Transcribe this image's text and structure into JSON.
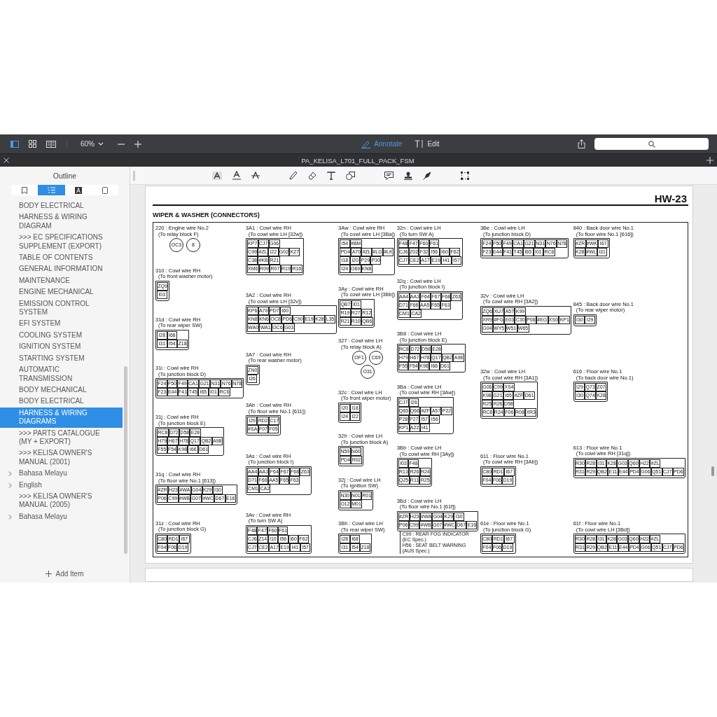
{
  "toolbar": {
    "views": [
      {
        "selected": true
      },
      {
        "selected": false
      },
      {
        "selected": false
      }
    ],
    "zoom": "60%",
    "modes": [
      {
        "label": "Annotate",
        "selected": true
      },
      {
        "label": "Edit",
        "selected": false
      }
    ]
  },
  "tab": {
    "title": "PA_KELISA_L701_FULL_PACK_FSM"
  },
  "sidebar": {
    "title": "Outline",
    "tabs": [
      {
        "selected": false
      },
      {
        "selected": true
      },
      {
        "selected": false
      },
      {
        "selected": false
      }
    ],
    "items": [
      {
        "label": "BODY ELECTRICAL",
        "kind": "entry",
        "selected": false
      },
      {
        "label": "HARNESS & WIRING DIAGRAM",
        "kind": "entry",
        "selected": false
      },
      {
        "label": ">>> EC SPECIFICATIONS SUPPLEMENT (EXPORT)",
        "kind": "entry",
        "selected": false
      },
      {
        "label": "TABLE OF CONTENTS",
        "kind": "entry",
        "selected": false
      },
      {
        "label": "GENERAL INFORMATION",
        "kind": "entry",
        "selected": false
      },
      {
        "label": "MAINTENANCE",
        "kind": "entry",
        "selected": false
      },
      {
        "label": "ENGINE MECHANICAL",
        "kind": "entry",
        "selected": false
      },
      {
        "label": "EMISSION CONTROL SYSTEM",
        "kind": "entry",
        "selected": false
      },
      {
        "label": "EFI SYSTEM",
        "kind": "entry",
        "selected": false
      },
      {
        "label": "COOLING SYSTEM",
        "kind": "entry",
        "selected": false
      },
      {
        "label": "IGNITION SYSTEM",
        "kind": "entry",
        "selected": false
      },
      {
        "label": "STARTING SYSTEM",
        "kind": "entry",
        "selected": false
      },
      {
        "label": "AUTOMATIC TRANSMISSION",
        "kind": "entry",
        "selected": false
      },
      {
        "label": "BODY MECHANICAL",
        "kind": "entry",
        "selected": false
      },
      {
        "label": "BODY ELECTRICAL",
        "kind": "entry",
        "selected": false
      },
      {
        "label": "HARNESS & WIRING DIAGRAMS",
        "kind": "entry",
        "selected": true
      },
      {
        "label": ">>> PARTS CATALOGUE (MY + EXPORT)",
        "kind": "entry",
        "selected": false
      },
      {
        "label": ">>> KELISA OWNER'S MANUAL (2001)",
        "kind": "entry",
        "selected": false
      },
      {
        "label": "Bahasa Melayu",
        "kind": "folder",
        "selected": false
      },
      {
        "label": "English",
        "kind": "folder",
        "selected": false
      },
      {
        "label": ">>> KELISA OWNER'S MANUAL (2005)",
        "kind": "entry",
        "selected": false
      },
      {
        "label": "Bahasa Melayu",
        "kind": "folder",
        "selected": false
      }
    ],
    "add_label": "Add Item"
  },
  "document": {
    "page_code": "HW-23",
    "heading": "WIPER & WASHER (CONNECTORS)",
    "columns": [
      [
        {
          "title": "220 : Engine wire No.2",
          "subtitle": "(To relay block F)",
          "kind": "round",
          "pins": [
            [
              "OC3",
              "8"
            ]
          ]
        },
        {
          "title": "310 : Cowl wire RH",
          "subtitle": "(To front washer motor)",
          "kind": "grid",
          "pins": [
            [
              "ZQ9"
            ],
            [
              "I03"
            ]
          ]
        },
        {
          "title": "31d : Cowl wire RH",
          "subtitle": "(To rear wiper SW)",
          "kind": "grid",
          "pins": [
            [
              "I28",
              "I68"
            ],
            [
              "I31",
              "I54",
              "Z18"
            ]
          ]
        },
        {
          "title": "31i : Cowl wire RH",
          "subtitle": "(To junction block D)",
          "kind": "grid",
          "pins": [
            [
              "F24",
              "F50",
              "F49",
              "CA1",
              "G21",
              "N31",
              "N76",
              "N78"
            ],
            [
              "F23",
              "E44",
              "F41",
              "T45",
              "I65",
              "I01",
              "RC6"
            ]
          ]
        },
        {
          "title": "31j : Cowl wire RH",
          "subtitle": "(To junction block E)",
          "kind": "grid",
          "pins": [
            [
              "RC8",
              "D72",
              "D58",
              "E28"
            ],
            [
              "H79",
              "H67",
              "H78",
              "Q17",
              "QB2",
              "A98"
            ],
            [
              "F55",
              "F54",
              "K98",
              "I66",
              "D61"
            ]
          ]
        },
        {
          "title": "31q : Cowl wire RH",
          "subtitle": "(To floor wire No.1 [613])",
          "kind": "grid",
          "pins": [
            [
              "#ZR",
              "H23",
              "#WA",
              "G04",
              "K29",
              "I30"
            ],
            [
              "P06",
              "C99",
              "#WB",
              "G07",
              "#WC",
              "D67",
              "E16"
            ]
          ]
        },
        {
          "title": "31z : Cowl wire RH",
          "subtitle": "(To junction block G)",
          "kind": "grid",
          "pins": [
            [
              "C80",
              "RD1",
              "I67"
            ],
            [
              "F04",
              "F06",
              "D19"
            ]
          ]
        }
      ],
      [
        {
          "title": "3A1 : Cowl wire RH",
          "subtitle": "(To cowl wire LH [32w])",
          "kind": "grid",
          "pins": [
            [
              "KP7",
              "CJ7",
              "G06"
            ],
            [
              "C99",
              "#ZL",
              "I22",
              "G02",
              "K27"
            ],
            [
              "C38",
              "#KB",
              "R21"
            ],
            [
              "XM6",
              "R09",
              "R07",
              "R19",
              "R16"
            ]
          ]
        },
        {
          "title": "3A2 : Cowl wire RH",
          "subtitle": "(To cowl wire LH [32v])",
          "kind": "grid",
          "pins": [
            [
              "KP6",
              "A70",
              "PD7",
              "I60"
            ],
            [
              "KN8",
              "KN6",
              "OC8",
              "PD6",
              "C90",
              "E19",
              "K28",
              "L35"
            ],
            [
              "WA0",
              "WA1",
              "OC6",
              "G03"
            ]
          ]
        },
        {
          "title": "3A7 : Cowl wire RH",
          "subtitle": "(To rear washer motor)",
          "kind": "grid",
          "pins": [
            [
              "ZN0"
            ],
            [
              "I26"
            ]
          ]
        },
        {
          "title": "3Ab : Cowl wire RH",
          "subtitle": "(To floor wire No.1 [611])",
          "kind": "grid",
          "pins": [
            [
              "I29",
              "RD2",
              "C17"
            ],
            [
              "#SA",
              "F07",
              "F05"
            ]
          ]
        },
        {
          "title": "3As : Cowl wire RH",
          "subtitle": "(To junction block I)",
          "kind": "grid",
          "pins": [
            [
              "AA4",
              "AA3",
              "F64",
              "F67",
              "F68",
              "Z63"
            ],
            [
              "D71",
              "F66",
              "AA5",
              "F65",
              "F63"
            ],
            [
              "CM1",
              "CA2"
            ]
          ]
        },
        {
          "title": "3Av : Cowl wire RH",
          "subtitle": "(To turn SW A)",
          "kind": "grid",
          "pins": [
            [
              "F48",
              "F47",
              "F60",
              "F61"
            ],
            [
              "CJ6",
              "Z14",
              "I10",
              "I56",
              "I60",
              "F62"
            ],
            [
              "CJ7",
              "CE2",
              "A17",
              "E19",
              "I41",
              "I57"
            ]
          ]
        }
      ],
      [
        {
          "title": "3Aw : Cowl wire RH",
          "subtitle": "(To cowl wire LH [3Ba])",
          "kind": "grid",
          "pins": [
            [
              "I54",
              "#BM"
            ],
            [
              "PD4",
              "A70",
              "#ZL",
              "#LG",
              "#LK"
            ],
            [
              "I18",
              "I20",
              "P29",
              "P30"
            ],
            [
              "I24",
              "O69",
              "KN8"
            ]
          ]
        },
        {
          "title": "3Ay : Cowl wire RH",
          "subtitle": "(To cowl wire LH [3Bb])",
          "kind": "grid",
          "pins": [
            [
              "QB7",
              "I01"
            ],
            [
              "R19",
              "R27",
              "R12"
            ],
            [
              "R21",
              "R10",
              "QB6"
            ]
          ]
        },
        {
          "title": "327 : Cowl wire LH",
          "subtitle": "(To relay block A)",
          "kind": "round",
          "pins": [
            [
              "OF1",
              "C69"
            ],
            [
              "O31"
            ]
          ]
        },
        {
          "title": "32c : Cowl wire LH",
          "subtitle": "(To front wiper motor)",
          "kind": "grid",
          "pins": [
            [
              "I20",
              "I18"
            ],
            [
              "I24",
              "I22"
            ]
          ]
        },
        {
          "title": "32h : Cowl wire LH",
          "subtitle": "(To junction block A)",
          "kind": "grid",
          "pins": [
            [
              "N59",
              "N60"
            ],
            [
              "PD4",
              "R02"
            ]
          ]
        },
        {
          "title": "32j : Cowl wire LH",
          "subtitle": "(To ignition SW)",
          "kind": "grid",
          "pins": [
            [
              "N30",
              "N01",
              "R01"
            ],
            [
              "O12",
              "M01"
            ]
          ]
        },
        {
          "title": "3Bh : Cowl wire LH",
          "subtitle": "(To rear wiper SW)",
          "kind": "grid",
          "pins": [
            [
              "I28",
              "I68"
            ],
            [
              "I31",
              "I54",
              "Z18"
            ]
          ]
        }
      ],
      [
        {
          "title": "32n : Cowl wire LH",
          "subtitle": "(To turn SW A)",
          "kind": "grid",
          "pins": [
            [
              "F48",
              "F47",
              "F60",
              "F61"
            ],
            [
              "CJ6",
              "Z02",
              "F32",
              "I56",
              "I60",
              "F62"
            ],
            [
              "CJ7",
              "CE2",
              "A17",
              "E19",
              "I41",
              "I57"
            ]
          ]
        },
        {
          "title": "32q : Cowl wire LH",
          "subtitle": "(To junction block I)",
          "kind": "grid",
          "pins": [
            [
              "AA4",
              "AA3",
              "F64",
              "F67",
              "F68",
              "Z63"
            ],
            [
              "D71",
              "F66",
              "AA5",
              "F65",
              "F63"
            ],
            [
              "CM1",
              "CA2"
            ]
          ]
        },
        {
          "title": "3B8 : Cowl wire LH",
          "subtitle": "(To junction block E)",
          "kind": "grid",
          "pins": [
            [
              "RC8",
              "D72",
              "D58",
              "E28"
            ],
            [
              "H79",
              "H67",
              "H78",
              "Q17",
              "QB2",
              "A98"
            ],
            [
              "F55",
              "F54",
              "K98",
              "I66",
              "D61"
            ]
          ]
        },
        {
          "title": "3Ba : Cowl wire LH",
          "subtitle": "(To cowl wire RH [3Aw])",
          "kind": "grid",
          "pins": [
            [
              "CJ7",
              "I26"
            ],
            [
              "Q65",
              "Q66",
              "#ZF",
              "A57",
              "P22"
            ],
            [
              "P28",
              "P27",
              "I57",
              "I56"
            ],
            [
              "KP1",
              "A22",
              "I41"
            ]
          ]
        },
        {
          "title": "3Bb : Cowl wire LH",
          "subtitle": "(To cowl wire RH [3Ay])",
          "kind": "grid",
          "pins": [
            [
              "I03",
              "F48"
            ],
            [
              "R13",
              "R26",
              "R24"
            ],
            [
              "Q25",
              "R11",
              "R25"
            ]
          ]
        },
        {
          "title": "3Bd : Cowl wire LH",
          "subtitle": "(To floor wire No.1 [61f])",
          "kind": "grid",
          "pins": [
            [
              "#ZR",
              "H23",
              "#WA",
              "G04",
              "K29",
              "I30"
            ],
            [
              "P06",
              "C99",
              "#WB",
              "G07",
              "#WC",
              "D67",
              "E16"
            ]
          ],
          "notes": [
            "C99 : REAR FOG INDICATOR (EC Spec.)",
            "H56 : SEAT BELT WARNING (AUS Spec.)"
          ]
        }
      ],
      [
        {
          "title": "3Be : Cowl wire LH",
          "subtitle": "(To junction block D)",
          "kind": "grid",
          "pins": [
            [
              "F24",
              "F50",
              "F49",
              "CA1",
              "G21",
              "N31",
              "N76",
              "N78"
            ],
            [
              "F23",
              "E44",
              "F41",
              "T45",
              "I65",
              "I01",
              "RC6"
            ]
          ]
        },
        {
          "title": "32v : Cowl wire LH",
          "subtitle": "(To cowl wire RH [3A2])",
          "kind": "grid",
          "pins": [
            [
              "ZQ6",
              "XU7",
              "A57",
              "K99"
            ],
            [
              "XR9",
              "#FG",
              "E03",
              "C30",
              "P06",
              "#EG",
              "XS0",
              "KP1"
            ],
            [
              "G04",
              "WY5",
              "W51",
              "W65"
            ]
          ]
        },
        {
          "title": "32w : Cowl wire LH",
          "subtitle": "(To cowl wire RH [3A1])",
          "kind": "grid",
          "pins": [
            [
              "G06",
              "C99",
              "XS4"
            ],
            [
              "K98",
              "G21",
              "I65",
              "#ZF",
              "D61"
            ],
            [
              "R25",
              "R26",
              "D58"
            ],
            [
              "RC8",
              "R24",
              "F06",
              "R08",
              "XR3"
            ]
          ]
        },
        {
          "title": "611 : Floor wire No.1",
          "subtitle": "(To cowl wire RH [3Ab])",
          "kind": "grid",
          "pins": [
            [
              "C80",
              "RD1",
              "I67"
            ],
            [
              "F04",
              "F06",
              "D19"
            ]
          ]
        },
        {
          "title": "61e : Floor wire No.1",
          "subtitle": "(To junction block G)",
          "kind": "grid",
          "pins": [
            [
              "C80",
              "RD1",
              "I67"
            ],
            [
              "F04",
              "F06",
              "D19"
            ]
          ]
        }
      ],
      [
        {
          "title": "840 : Back door wire No.1",
          "subtitle": "(To floor wire No.1 [616])",
          "kind": "grid",
          "pins": [
            [
              "#ZR",
              "#WK",
              "I67"
            ],
            [
              "K28",
              "#WL",
              "I31"
            ]
          ]
        },
        {
          "title": "845 : Back door wire No.1",
          "subtitle": "(To rear wiper motor)",
          "kind": "grid",
          "pins": [
            [
              "I30",
              "I29"
            ]
          ]
        },
        {
          "title": "616 : Floor wire No.1",
          "subtitle": "(To back door wire No.1)",
          "kind": "grid",
          "pins": [
            [
              "I29",
              "Q73",
              "Z07"
            ],
            [
              "I30",
              "Q74",
              "K28"
            ]
          ]
        },
        {
          "title": "613 : Floor wire No.1",
          "subtitle": "(To cowl wire RH [31q])",
          "kind": "grid",
          "pins": [
            [
              "R30",
              "R28",
              "I31",
              "K28",
              "G03",
              "Q60",
              "H22",
              "#ZL"
            ],
            [
              "R31",
              "R29",
              "QB2",
              "E11",
              "E44",
              "PD4",
              "G06",
              "Q51",
              "CJ7",
              "PD6"
            ]
          ]
        },
        {
          "title": "61f : Floor wire No.1",
          "subtitle": "(To cowl wire LH [3Bd])",
          "kind": "grid",
          "pins": [
            [
              "R30",
              "R28",
              "I31",
              "K28",
              "G03",
              "Q60",
              "H22",
              "#ZL"
            ],
            [
              "R31",
              "R29",
              "QB2",
              "E11",
              "E44",
              "PD4",
              "G06",
              "Q51",
              "CJ7",
              "PD6"
            ]
          ]
        }
      ]
    ]
  }
}
